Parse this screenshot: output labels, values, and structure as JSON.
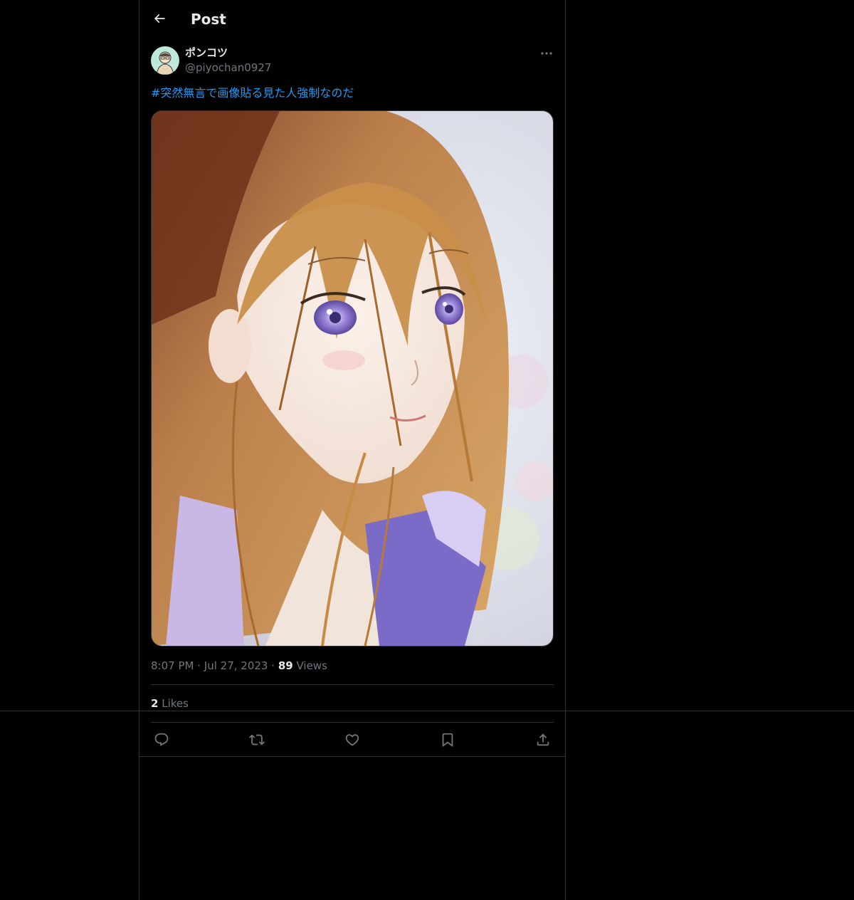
{
  "header": {
    "title": "Post",
    "back_icon": "arrow-left-icon"
  },
  "author": {
    "display_name": "ポンコツ",
    "handle": "@piyochan0927",
    "more_icon": "more-dots-icon"
  },
  "tweet": {
    "text": "#突然無言で画像貼る見た人強制なのだ",
    "media_description": "anime-style illustration of a girl with light brown hair and violet eyes, floral background"
  },
  "meta": {
    "time": "8:07 PM",
    "separator": "·",
    "date": "Jul 27, 2023",
    "views_count": "89",
    "views_label": "Views"
  },
  "stats": {
    "likes_count": "2",
    "likes_label": "Likes"
  },
  "actions": [
    {
      "icon": "reply-icon"
    },
    {
      "icon": "retweet-icon"
    },
    {
      "icon": "like-heart-icon"
    },
    {
      "icon": "bookmark-icon"
    },
    {
      "icon": "share-icon"
    }
  ],
  "colors": {
    "background": "#000000",
    "text_primary": "#e7e9ea",
    "text_secondary": "#71767b",
    "link": "#1d9bf0",
    "border": "#2f3336"
  }
}
